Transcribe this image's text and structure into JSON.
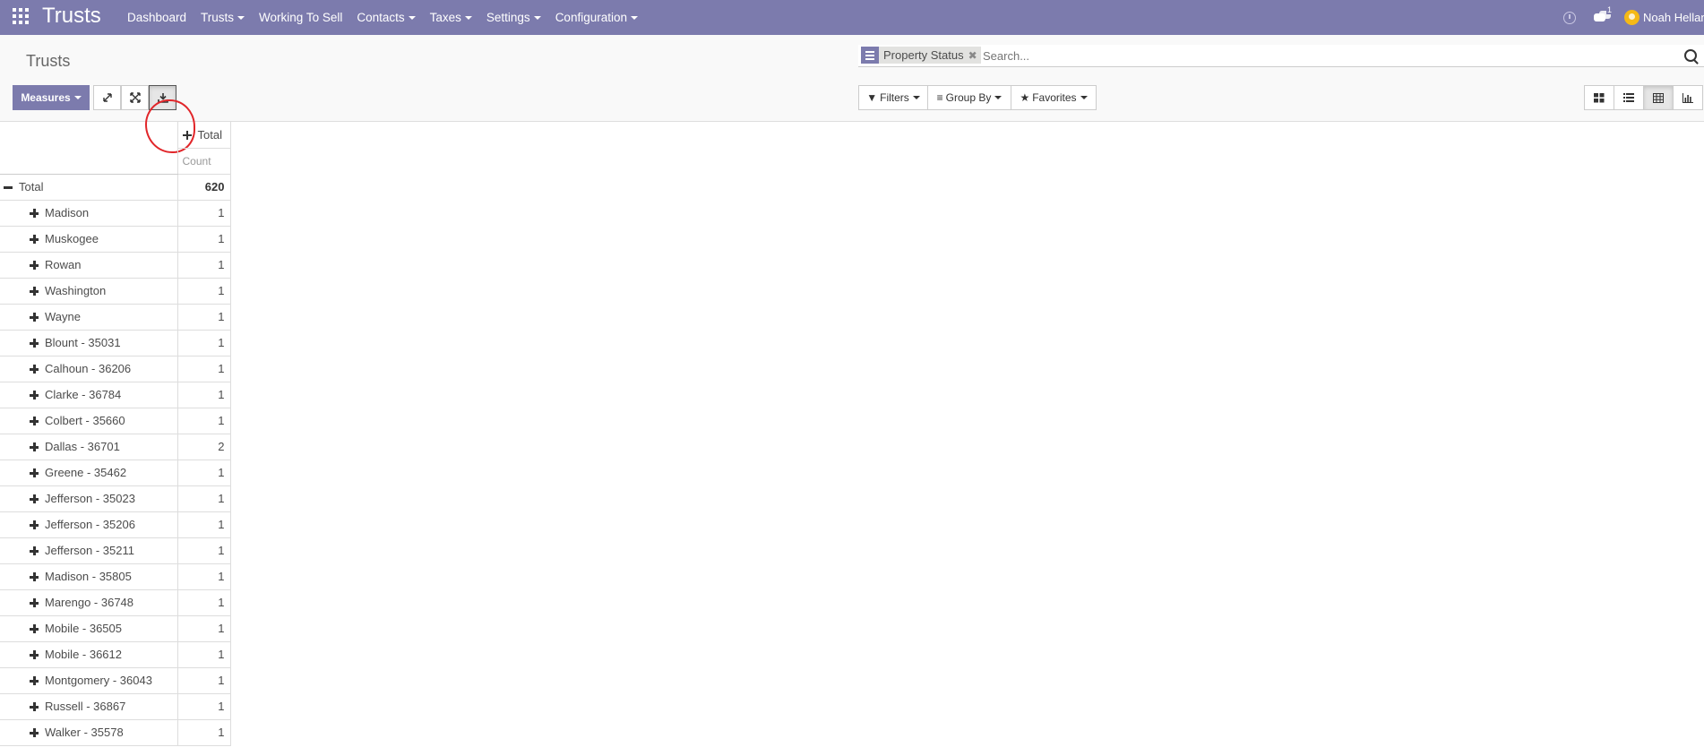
{
  "navbar": {
    "brand": "Trusts",
    "menu": [
      {
        "label": "Dashboard",
        "dropdown": false
      },
      {
        "label": "Trusts",
        "dropdown": true
      },
      {
        "label": "Working To Sell",
        "dropdown": false
      },
      {
        "label": "Contacts",
        "dropdown": true
      },
      {
        "label": "Taxes",
        "dropdown": true
      },
      {
        "label": "Settings",
        "dropdown": true
      },
      {
        "label": "Configuration",
        "dropdown": true
      }
    ],
    "chat_badge": "1",
    "user_name": "Noah Hellan"
  },
  "control_panel": {
    "breadcrumb": "Trusts",
    "search": {
      "facet": "Property Status",
      "placeholder": "Search..."
    },
    "measures_label": "Measures",
    "filters_label": "Filters",
    "groupby_label": "Group By",
    "favorites_label": "Favorites"
  },
  "pivot": {
    "col_header": "Total",
    "measure": "Count",
    "total_label": "Total",
    "total_value": "620",
    "rows": [
      {
        "label": "Madison",
        "value": "1"
      },
      {
        "label": "Muskogee",
        "value": "1"
      },
      {
        "label": "Rowan",
        "value": "1"
      },
      {
        "label": "Washington",
        "value": "1"
      },
      {
        "label": "Wayne",
        "value": "1"
      },
      {
        "label": "Blount - 35031",
        "value": "1"
      },
      {
        "label": "Calhoun - 36206",
        "value": "1"
      },
      {
        "label": "Clarke - 36784",
        "value": "1"
      },
      {
        "label": "Colbert - 35660",
        "value": "1"
      },
      {
        "label": "Dallas - 36701",
        "value": "2"
      },
      {
        "label": "Greene - 35462",
        "value": "1"
      },
      {
        "label": "Jefferson - 35023",
        "value": "1"
      },
      {
        "label": "Jefferson - 35206",
        "value": "1"
      },
      {
        "label": "Jefferson - 35211",
        "value": "1"
      },
      {
        "label": "Madison - 35805",
        "value": "1"
      },
      {
        "label": "Marengo - 36748",
        "value": "1"
      },
      {
        "label": "Mobile - 36505",
        "value": "1"
      },
      {
        "label": "Mobile - 36612",
        "value": "1"
      },
      {
        "label": "Montgomery - 36043",
        "value": "1"
      },
      {
        "label": "Russell - 36867",
        "value": "1"
      },
      {
        "label": "Walker - 35578",
        "value": "1"
      }
    ]
  },
  "colors": {
    "brand": "#7c7bad",
    "annotation": "#e1262a"
  }
}
